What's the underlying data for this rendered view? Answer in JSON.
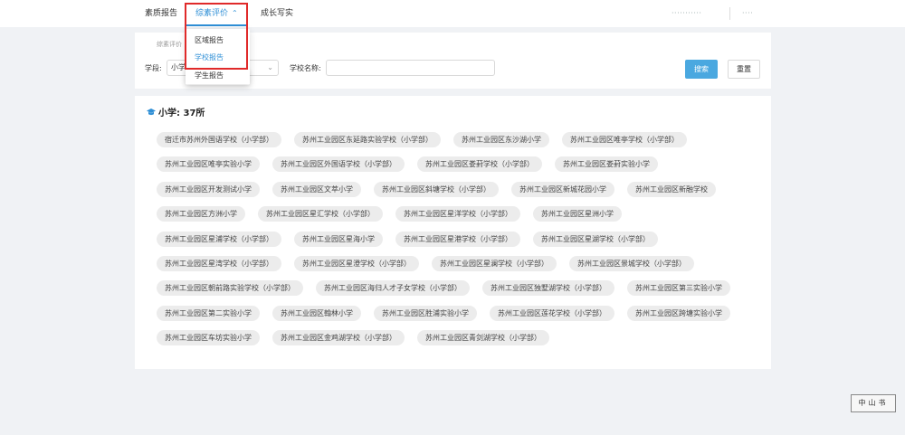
{
  "nav": {
    "items": [
      "素质报告",
      "综素评价",
      "成长写实"
    ],
    "active_index": 1,
    "user_blurred": "···········",
    "user_blurred2": "····"
  },
  "dropdown": {
    "items": [
      "区域报告",
      "学校报告",
      "学生报告"
    ],
    "active_index": 1
  },
  "filter": {
    "breadcrumb": "综素评价",
    "stage_label": "学段:",
    "stage_value": "小学",
    "school_label": "学校名称:",
    "school_value": "",
    "search_btn": "搜索",
    "reset_btn": "重置"
  },
  "list": {
    "title": "小学: 37所",
    "rows": [
      [
        "宿迁市苏州外国语学校（小学部）",
        "苏州工业园区东延路实验学校（小学部）",
        "苏州工业园区东沙湖小学",
        "苏州工业园区唯亭学校（小学部）"
      ],
      [
        "苏州工业园区唯亭实验小学",
        "苏州工业园区外国语学校（小学部）",
        "苏州工业园区娄葑学校（小学部）",
        "苏州工业园区娄葑实验小学"
      ],
      [
        "苏州工业园区开发测试小学",
        "苏州工业园区文萃小学",
        "苏州工业园区斜塘学校（小学部）",
        "苏州工业园区新城花园小学",
        "苏州工业园区新融学校"
      ],
      [
        "苏州工业园区方洲小学",
        "苏州工业园区星汇学校（小学部）",
        "苏州工业园区星洋学校（小学部）",
        "苏州工业园区星洲小学"
      ],
      [
        "苏州工业园区星浦学校（小学部）",
        "苏州工业园区星海小学",
        "苏州工业园区星港学校（小学部）",
        "苏州工业园区星湖学校（小学部）"
      ],
      [
        "苏州工业园区星湾学校（小学部）",
        "苏州工业园区星澄学校（小学部）",
        "苏州工业园区星澜学校（小学部）",
        "苏州工业园区景城学校（小学部）"
      ],
      [
        "苏州工业园区朝前路实验学校（小学部）",
        "苏州工业园区海归人才子女学校（小学部）",
        "苏州工业园区独墅湖学校（小学部）",
        "苏州工业园区第三实验小学"
      ],
      [
        "苏州工业园区第二实验小学",
        "苏州工业园区翰林小学",
        "苏州工业园区胜浦实验小学",
        "苏州工业园区莲花学校（小学部）",
        "苏州工业园区跨塘实验小学"
      ],
      [
        "苏州工业园区车坊实验小学",
        "苏州工业园区金鸡湖学校（小学部）",
        "苏州工业园区青剑湖学校（小学部）"
      ]
    ]
  },
  "stamp": "中山书"
}
